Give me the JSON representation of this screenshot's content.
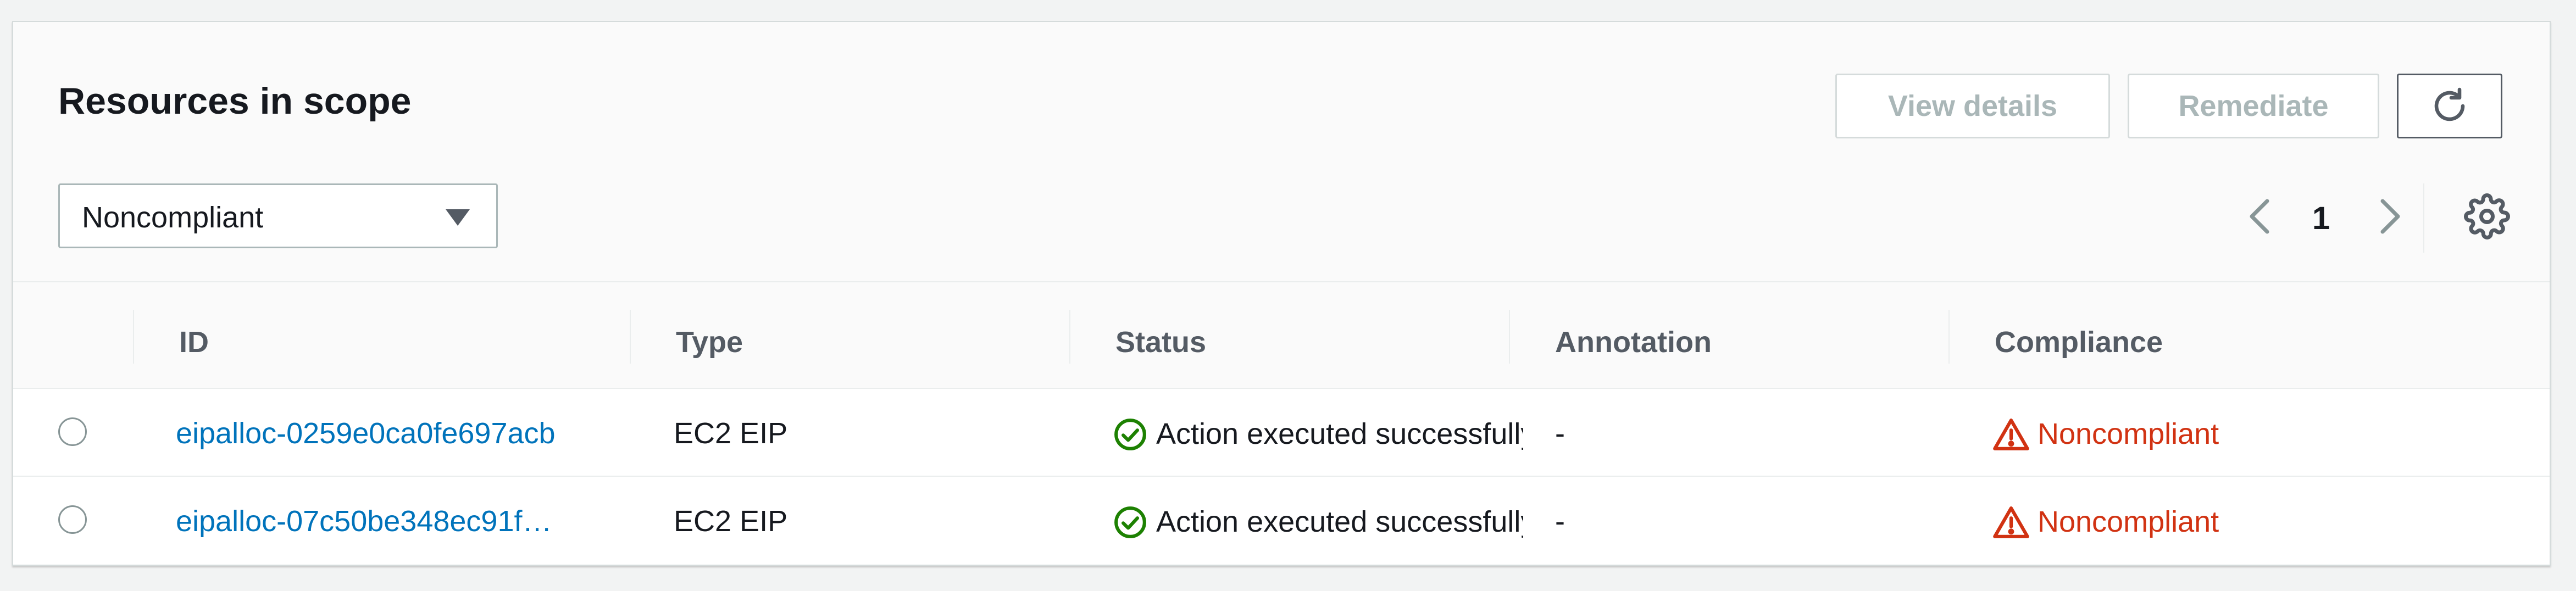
{
  "header": {
    "title": "Resources in scope",
    "buttons": {
      "view_details": "View details",
      "remediate": "Remediate",
      "refresh_icon": "refresh-icon"
    },
    "filter": {
      "selected": "Noncompliant"
    },
    "pagination": {
      "current_page": "1",
      "prev_icon": "chevron-left-icon",
      "next_icon": "chevron-right-icon",
      "settings_icon": "gear-icon"
    }
  },
  "table": {
    "columns": [
      "ID",
      "Type",
      "Status",
      "Annotation",
      "Compliance"
    ],
    "rows": [
      {
        "id": "eipalloc-0259e0ca0fe697acb",
        "type": "EC2 EIP",
        "status": "Action executed successfully",
        "annotation": "-",
        "compliance": "Noncompliant"
      },
      {
        "id": "eipalloc-07c50be348ec91f…",
        "type": "EC2 EIP",
        "status": "Action executed successfully",
        "annotation": "-",
        "compliance": "Noncompliant"
      }
    ]
  },
  "colors": {
    "link": "#0073bb",
    "success": "#1d8102",
    "error": "#d13212",
    "disabled_text": "#aab7b8"
  }
}
